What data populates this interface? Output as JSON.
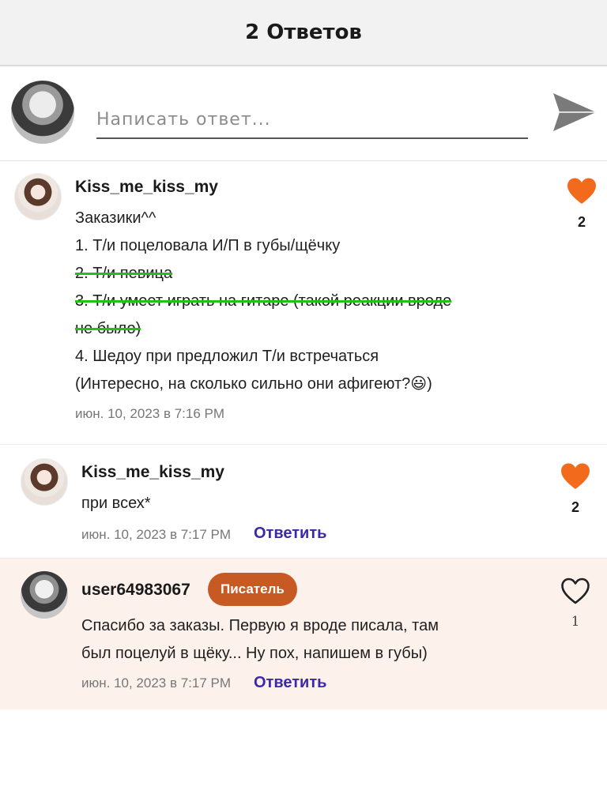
{
  "header": {
    "title": "2 Ответов"
  },
  "compose": {
    "placeholder": "Написать ответ..."
  },
  "comments": [
    {
      "author": "Kiss_me_kiss_my",
      "lines": [
        "Заказики^^",
        "1. Т/и поцеловала И/П в губы/щёчку",
        "2. Т/и певица",
        "3. Т/и умеет играть на гитаре (такой реакции вроде",
        "не было)",
        "4. Шедоу при предложил Т/и встречаться",
        "(Интересно, на сколько сильно они афигеют?😃)"
      ],
      "timestamp": "июн. 10, 2023 в 7:16 PM",
      "likes": "2"
    },
    {
      "author": "Kiss_me_kiss_my",
      "lines": [
        "при всех*"
      ],
      "timestamp": "июн. 10, 2023 в 7:17 PM",
      "reply_label": "Ответить",
      "likes": "2"
    },
    {
      "author": "user64983067",
      "badge": "Писатель",
      "lines": [
        "Спасибо за заказы. Первую я вроде писала, там",
        "был поцелуй в щёку... Ну пох, напишем в губы)"
      ],
      "timestamp": "июн. 10, 2023 в 7:17 PM",
      "reply_label": "Ответить",
      "likes": "1"
    }
  ],
  "colors": {
    "accent": "#3a2aa8",
    "like_active": "#f26a1b",
    "badge": "#c65a22",
    "strike": "#23c018",
    "highlight_bg": "#fdf1ec"
  },
  "icons": {
    "send": "send-icon",
    "like_filled": "heart-filled-icon",
    "like_outline": "heart-outline-icon"
  }
}
